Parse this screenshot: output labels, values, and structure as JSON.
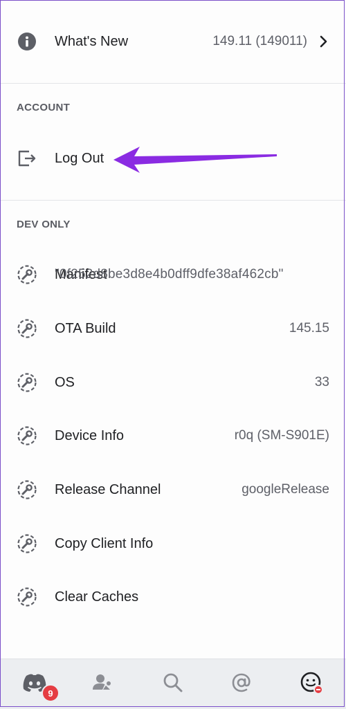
{
  "whats_new": {
    "label": "What's New",
    "value": "149.11 (149011)",
    "icon": "info-icon"
  },
  "account": {
    "title": "ACCOUNT",
    "logout_label": "Log Out"
  },
  "dev_only": {
    "title": "DEV ONLY",
    "manifest": {
      "label": "Manifest",
      "value": "\"0f252d8be3d8e4b0dff9dfe38af462cb\""
    },
    "ota_build": {
      "label": "OTA Build",
      "value": "145.15"
    },
    "os": {
      "label": "OS",
      "value": "33"
    },
    "device_info": {
      "label": "Device Info",
      "value": "r0q (SM-S901E)"
    },
    "release_channel": {
      "label": "Release Channel",
      "value": "googleRelease"
    },
    "copy_client_info": {
      "label": "Copy Client Info"
    },
    "clear_caches": {
      "label": "Clear Caches"
    }
  },
  "nav": {
    "home_badge": "9",
    "items": [
      "home-icon",
      "friends-icon",
      "search-icon",
      "mentions-icon",
      "profile-icon"
    ]
  },
  "colors": {
    "accent_arrow": "#8a2be2",
    "badge": "#e53d43",
    "nav_bg": "#eceef1"
  }
}
